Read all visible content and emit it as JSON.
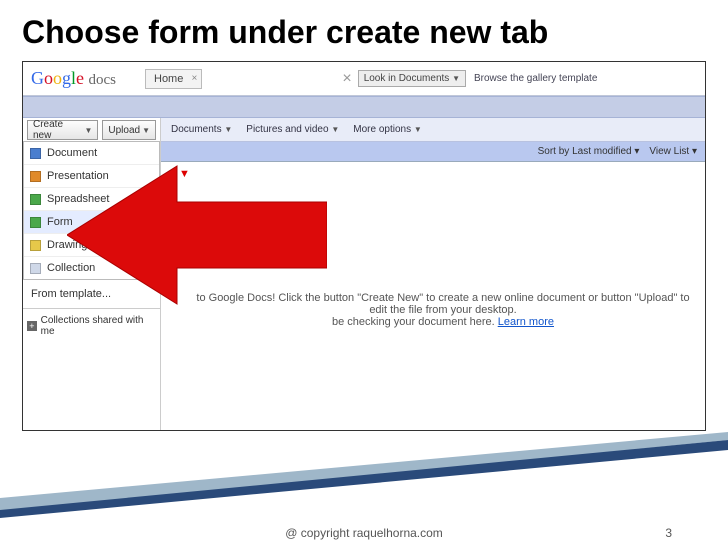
{
  "slide": {
    "title": "Choose form under create new tab",
    "copyright": "@ copyright raquelhorna.com",
    "page_number": "3"
  },
  "logo": {
    "text": "Google",
    "suffix": "docs"
  },
  "tabs": {
    "home": "Home"
  },
  "search": {
    "button": "Look in Documents",
    "browse": "Browse the gallery template"
  },
  "buttons": {
    "create_new": "Create new",
    "upload": "Upload"
  },
  "tools": {
    "documents": "Documents",
    "pictures": "Pictures and video",
    "more": "More options"
  },
  "menu": {
    "document": "Document",
    "presentation": "Presentation",
    "spreadsheet": "Spreadsheet",
    "form": "Form",
    "drawing": "Drawing",
    "collection": "Collection",
    "from_template": "From template..."
  },
  "sidebar": {
    "shared": "Collections shared with me"
  },
  "sort": {
    "sortby": "Sort by Last modified ▾",
    "viewlist": "View List ▾"
  },
  "welcome": {
    "line1": "to Google Docs! Click the button \"Create New\" to create a new online document or button \"Upload\" to edit the file from your desktop.",
    "line2_prefix": "be checking your document here. ",
    "learn_more": "Learn more"
  }
}
